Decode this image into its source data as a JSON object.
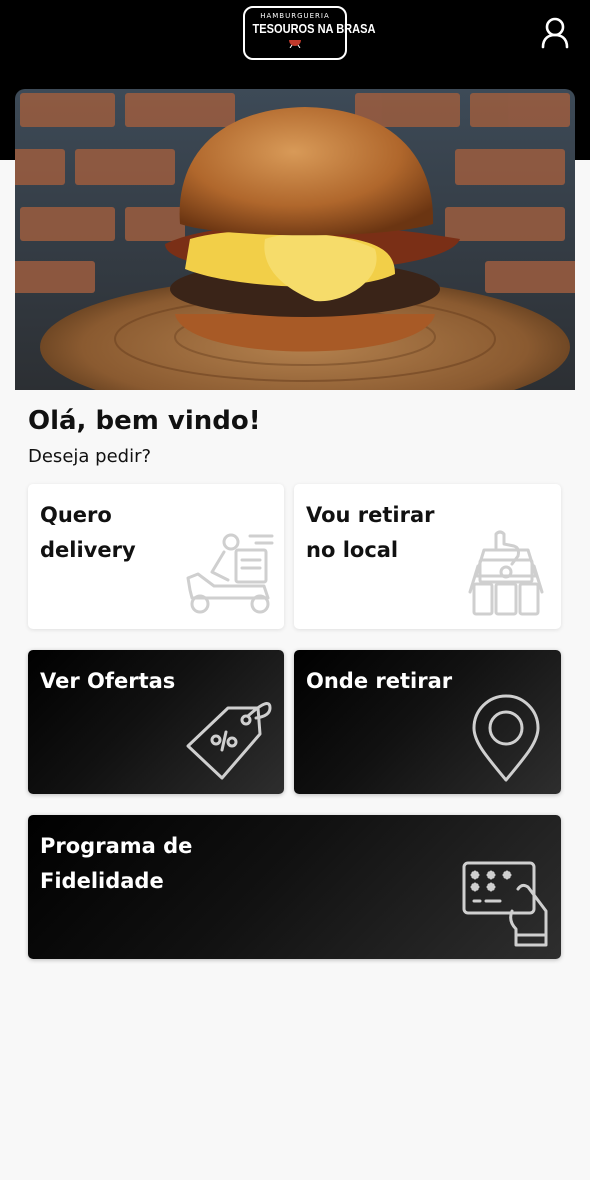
{
  "header": {
    "logo_small": "HAMBURGUERIA",
    "logo_main": "TESOUROS NA BRASA",
    "profile_icon": "user-icon"
  },
  "hero": {
    "image": "burger-photo"
  },
  "greeting": "Olá, bem vindo!",
  "subtitle": "Deseja pedir?",
  "cards": {
    "delivery": {
      "line1": "Quero",
      "line2": "delivery",
      "icon": "delivery-scooter-icon"
    },
    "pickup": {
      "line1": "Vou retirar",
      "line2": "no local",
      "icon": "pickup-icon"
    },
    "offers": {
      "label": "Ver Ofertas",
      "icon": "price-tag-icon"
    },
    "where": {
      "label": "Onde retirar",
      "icon": "location-pin-icon"
    },
    "loyalty": {
      "line1": "Programa de",
      "line2": "Fidelidade",
      "icon": "loyalty-card-icon"
    }
  },
  "colors": {
    "topbar": "#000000",
    "background": "#f8f8f8",
    "dark_card": "#111111",
    "icon_gray": "#cfcfcf"
  }
}
